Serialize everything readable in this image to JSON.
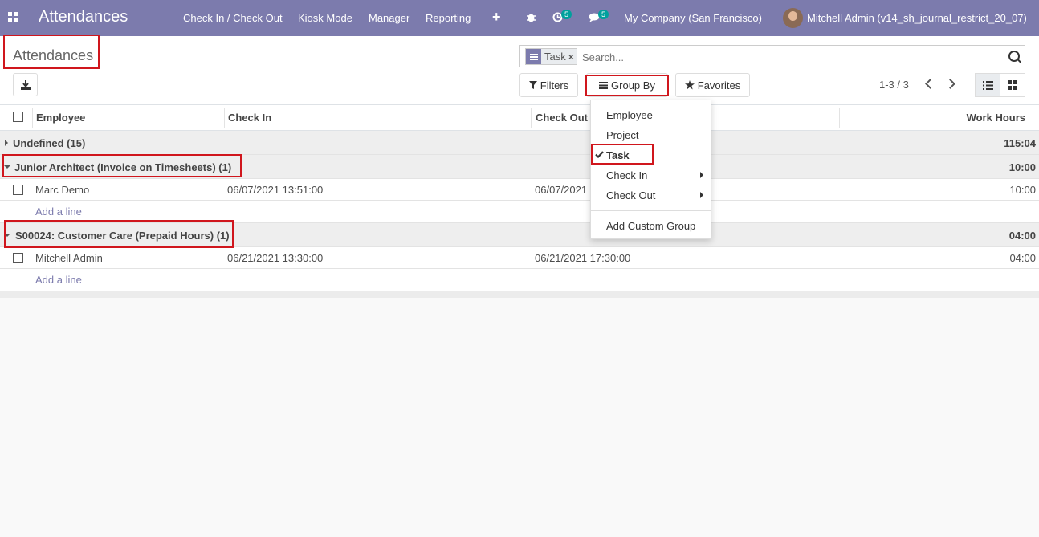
{
  "navbar": {
    "app_title": "Attendances",
    "menu": [
      "Check In / Check Out",
      "Kiosk Mode",
      "Manager",
      "Reporting"
    ],
    "activity_count": "5",
    "message_count": "5",
    "company": "My Company (San Francisco)",
    "user": "Mitchell Admin (v14_sh_journal_restrict_20_07)",
    "plus_icon": "+"
  },
  "control_panel": {
    "breadcrumb": "Attendances",
    "facet_label": "Task",
    "facet_remove": "×",
    "search_placeholder": "Search...",
    "filters_label": "Filters",
    "groupby_label": "Group By",
    "favorites_label": "Favorites",
    "pager": "1-3 / 3"
  },
  "table": {
    "headers": {
      "employee": "Employee",
      "check_in": "Check In",
      "check_out": "Check Out",
      "work_hours": "Work Hours"
    },
    "groups": [
      {
        "label": "Undefined (15)",
        "total": "115:04",
        "expanded": false
      },
      {
        "label": "Junior Architect (Invoice on Timesheets) (1)",
        "total": "10:00",
        "expanded": true,
        "records": [
          {
            "employee": "Marc Demo",
            "check_in": "06/07/2021 13:51:00",
            "check_out": "06/07/2021",
            "hours": "10:00"
          }
        ],
        "add_line": "Add a line"
      },
      {
        "label": "S00024: Customer Care (Prepaid Hours) (1)",
        "total": "04:00",
        "expanded": true,
        "records": [
          {
            "employee": "Mitchell Admin",
            "check_in": "06/21/2021 13:30:00",
            "check_out": "06/21/2021 17:30:00",
            "hours": "04:00"
          }
        ],
        "add_line": "Add a line"
      }
    ]
  },
  "groupby_menu": {
    "items": [
      "Employee",
      "Project",
      "Task",
      "Check In",
      "Check Out"
    ],
    "selected": "Task",
    "custom": "Add Custom Group"
  },
  "icons": [
    "apps-grid-icon",
    "bug-icon",
    "clock-icon",
    "chat-icon",
    "download-icon",
    "search-icon",
    "filter-icon",
    "list-icon",
    "star-icon",
    "kanban-icon",
    "check-icon"
  ],
  "colors": {
    "navbar": "#7c7bad",
    "highlight": "#d0161d",
    "badge": "#00a09d"
  }
}
